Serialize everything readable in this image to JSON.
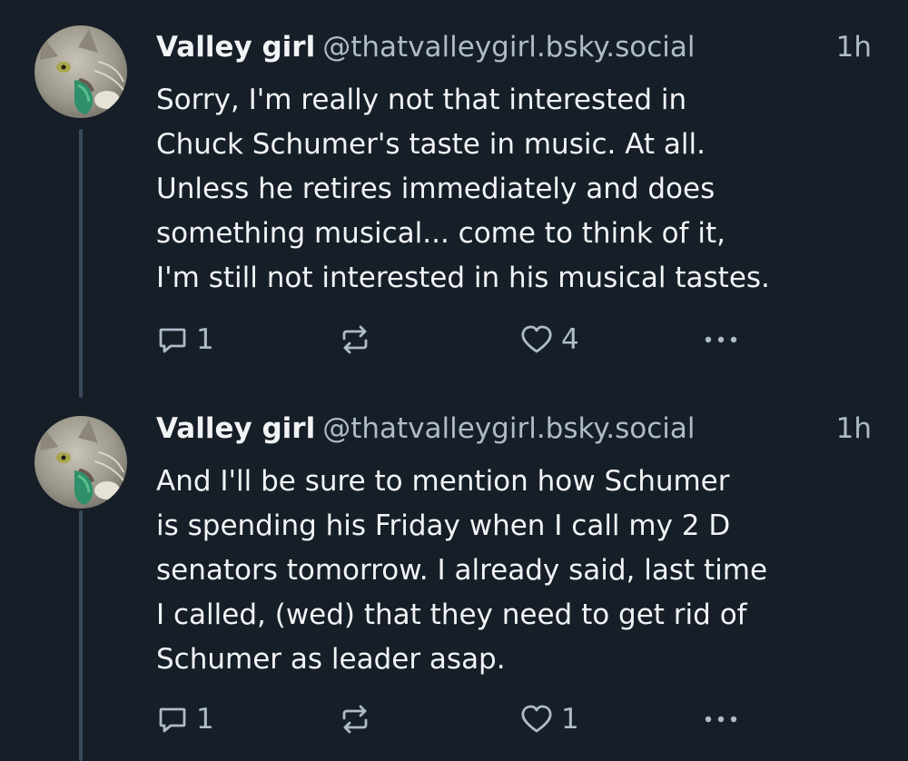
{
  "posts": [
    {
      "author": {
        "display_name": "Valley girl",
        "handle": "@thatvalleygirl.bsky.social"
      },
      "timestamp": "1h",
      "text": "Sorry, I'm really not that interested in\nChuck Schumer's taste in music.  At all.\nUnless he retires immediately and does\nsomething musical... come to think of it,\nI'm still not interested in his musical tastes.",
      "reply_count": "1",
      "like_count": "4",
      "icons": {
        "reply": "reply-icon",
        "repost": "repost-icon",
        "like": "heart-icon",
        "more": "more-options-icon"
      }
    },
    {
      "author": {
        "display_name": "Valley girl",
        "handle": "@thatvalleygirl.bsky.social"
      },
      "timestamp": "1h",
      "text": "And I'll be sure to mention how Schumer\nis spending his Friday when I call my 2 D\nsenators tomorrow.  I already said, last time\nI called, (wed) that they need to get rid of\nSchumer as leader asap.",
      "reply_count": "1",
      "like_count": "1",
      "icons": {
        "reply": "reply-icon",
        "repost": "repost-icon",
        "like": "heart-icon",
        "more": "more-options-icon"
      }
    }
  ],
  "colors": {
    "background": "#161e27",
    "text": "#f1f3f5",
    "muted": "#aebbc9",
    "thread_line": "#3a4a5c"
  }
}
